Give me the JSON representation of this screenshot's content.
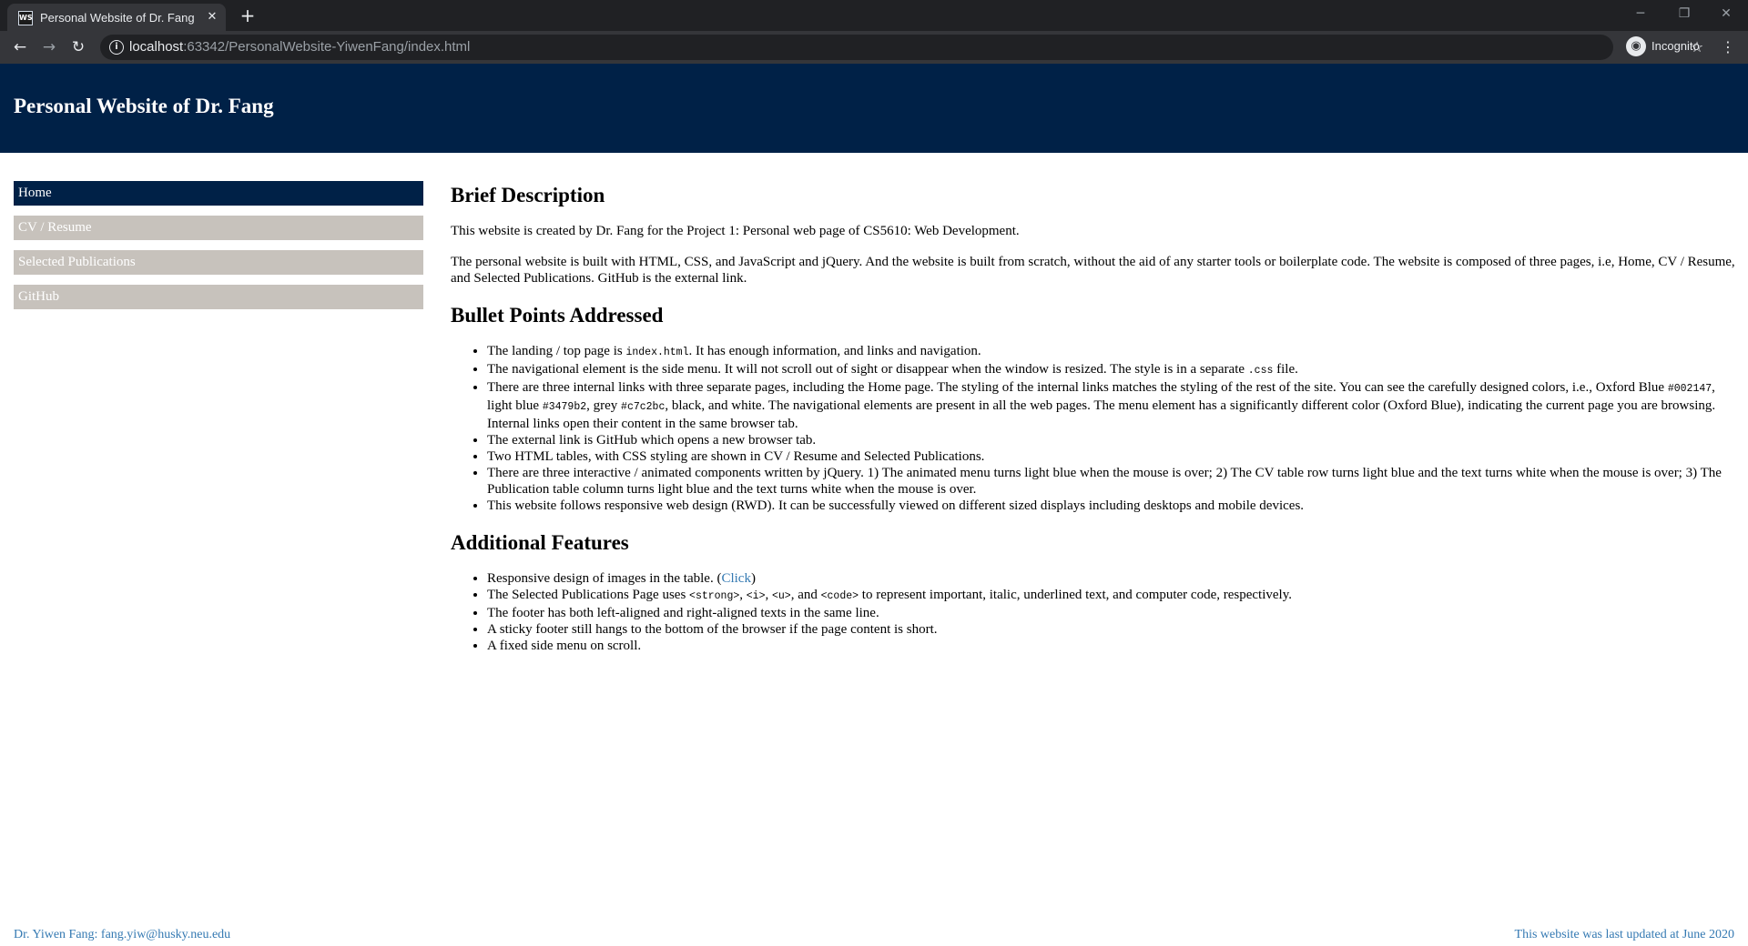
{
  "browser": {
    "tab_title": "Personal Website of Dr. Fang",
    "favicon_text": "WS",
    "url_host": "localhost",
    "url_rest": ":63342/PersonalWebsite-YiwenFang/index.html",
    "incognito_label": "Incognito"
  },
  "header": {
    "title": "Personal Website of Dr. Fang"
  },
  "menu": {
    "items": [
      {
        "label": "Home",
        "active": true
      },
      {
        "label": "CV / Resume",
        "active": false
      },
      {
        "label": "Selected Publications",
        "active": false
      },
      {
        "label": "GitHub",
        "active": false
      }
    ]
  },
  "content": {
    "brief": {
      "heading": "Brief Description",
      "p1": "This website is created by Dr. Fang for the Project 1: Personal web page of CS5610: Web Development.",
      "p2": "The personal website is built with HTML, CSS, and JavaScript and jQuery. And the website is built from scratch, without the aid of any starter tools or boilerplate code. The website is composed of three pages, i.e, Home, CV / Resume, and Selected Publications. GitHub is the external link."
    },
    "bullets": {
      "heading": "Bullet Points Addressed",
      "b1_pre": "The landing / top page is ",
      "b1_code": "index.html",
      "b1_post": ". It has enough information, and links and navigation.",
      "b2_pre": "The navigational element is the side menu. It will not scroll out of sight or disappear when the window is resized. The style is in a separate ",
      "b2_code": ".css",
      "b2_post": " file.",
      "b3_t1": "There are three internal links with three separate pages, including the Home page. The styling of the internal links matches the styling of the rest of the site. You can see the carefully designed colors, i.e., Oxford Blue ",
      "b3_c1": "#002147",
      "b3_t2": ", light blue ",
      "b3_c2": "#3479b2",
      "b3_t3": ", grey ",
      "b3_c3": "#c7c2bc",
      "b3_t4": ", black, and white. The navigational elements are present in all the web pages. The menu element has a significantly different color (Oxford Blue), indicating the current page you are browsing. Internal links open their content in the same browser tab.",
      "b4": "The external link is GitHub which opens a new browser tab.",
      "b5": "Two HTML tables, with CSS styling are shown in CV / Resume and Selected Publications.",
      "b6": "There are three interactive / animated components written by jQuery. 1) The animated menu turns light blue when the mouse is over; 2) The CV table row turns light blue and the text turns white when the mouse is over; 3) The Publication table column turns light blue and the text turns white when the mouse is over.",
      "b7": "This website follows responsive web design (RWD). It can be successfully viewed on different sized displays including desktops and mobile devices."
    },
    "additional": {
      "heading": "Additional Features",
      "a1_pre": "Responsive design of images in the table. (",
      "a1_link": "Click",
      "a1_post": ")",
      "a2_pre": "The Selected Publications Page uses ",
      "a2_c1": "<strong>",
      "a2_sep1": ", ",
      "a2_c2": "<i>",
      "a2_sep2": ", ",
      "a2_c3": "<u>",
      "a2_sep3": ", and ",
      "a2_c4": "<code>",
      "a2_post": " to represent important, italic, underlined text, and computer code, respectively.",
      "a3": "The footer has both left-aligned and right-aligned texts in the same line.",
      "a4": "A sticky footer still hangs to the bottom of the browser if the page content is short.",
      "a5": "A fixed side menu on scroll."
    }
  },
  "footer": {
    "left": "Dr. Yiwen Fang: fang.yiw@husky.neu.edu",
    "right": "This website was last updated at June 2020"
  },
  "colors": {
    "oxford_blue": "#002147",
    "light_blue": "#3479b2",
    "grey": "#c7c2bc"
  }
}
